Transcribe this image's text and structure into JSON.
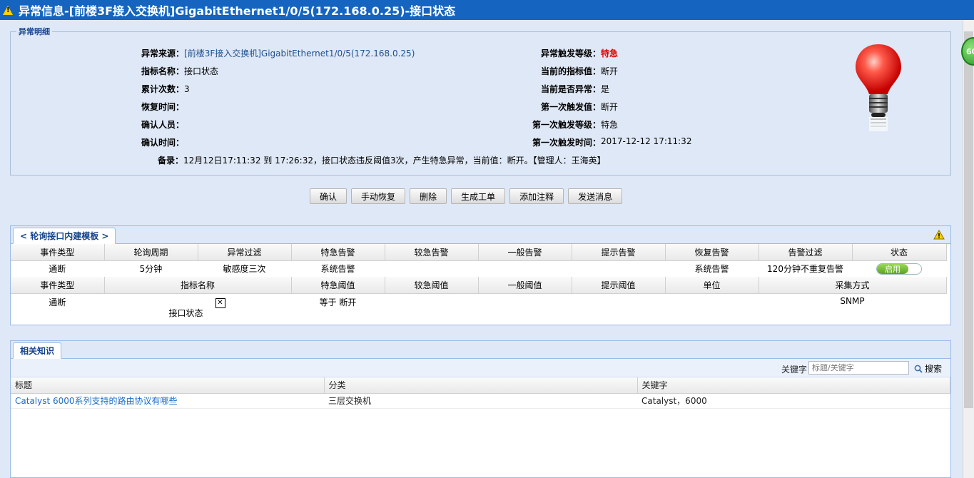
{
  "window": {
    "title": "异常信息-[前楼3F接入交换机]GigabitEthernet1/0/5(172.168.0.25)-接口状态",
    "badge_text": "60"
  },
  "detail": {
    "legend": "异常明细",
    "left": [
      {
        "label": "异常来源：",
        "value": "[前楼3F接入交换机]GigabitEthernet1/0/5(172.168.0.25)"
      },
      {
        "label": "指标名称：",
        "value": "接口状态"
      },
      {
        "label": "累计次数：",
        "value": "3"
      },
      {
        "label": "恢复时间：",
        "value": ""
      },
      {
        "label": "确认人员：",
        "value": ""
      },
      {
        "label": "确认时间：",
        "value": ""
      }
    ],
    "right": [
      {
        "label": "异常触发等级：",
        "value": "特急"
      },
      {
        "label": "当前的指标值：",
        "value": "断开"
      },
      {
        "label": "当前是否异常：",
        "value": "是"
      },
      {
        "label": "第一次触发值：",
        "value": "断开"
      },
      {
        "label": "第一次触发等级：",
        "value": "特急"
      },
      {
        "label": "第一次触发时间：",
        "value": "2017-12-12 17:11:32"
      }
    ],
    "remark_label": "备录：",
    "remark_value": "12月12日17:11:32 到 17:26:32，接口状态违反阈值3次，产生特急异常，当前值：断开。【管理人：王海英】",
    "colors": {
      "link": "#1d4f91",
      "urgent": "#e00000"
    },
    "icon": "red-lightbulb-icon"
  },
  "actions": [
    "确认",
    "手动恢复",
    "删除",
    "生成工单",
    "添加注释",
    "发送消息"
  ],
  "template_panel": {
    "tab_label": "< 轮询接口内建模板 >",
    "icon": "warning-icon",
    "header1": [
      "事件类型",
      "轮询周期",
      "异常过滤",
      "特急告警",
      "较急告警",
      "一般告警",
      "提示告警",
      "恢复告警",
      "告警过滤",
      "状态"
    ],
    "row1": [
      "通断",
      "5分钟",
      "敏感度三次",
      "系统告警",
      "",
      "",
      "",
      "系统告警",
      "120分钟不重复告警"
    ],
    "status_label": "启用",
    "header2": [
      "事件类型",
      "指标名称",
      "特急阈值",
      "较急阈值",
      "一般阈值",
      "提示阈值",
      "单位",
      "采集方式"
    ],
    "row2": {
      "event": "通断",
      "metric": "接口状态",
      "urgent": "等于 断开",
      "major": "",
      "normal": "",
      "hint": "",
      "unit": "",
      "method": "SNMP"
    }
  },
  "knowledge": {
    "tab_label": "相关知识",
    "keyword_label": "关键字",
    "search_placeholder": "标题/关键字",
    "search_button": "搜索",
    "columns": [
      "标题",
      "分类",
      "关键字"
    ],
    "rows": [
      {
        "title": "Catalyst 6000系列支持的路由协议有哪些",
        "category": "三层交换机",
        "keywords": "Catalyst，6000"
      }
    ]
  }
}
